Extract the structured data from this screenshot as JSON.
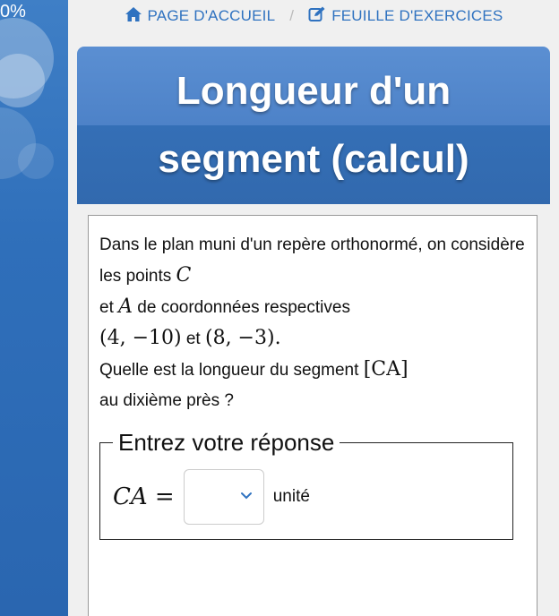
{
  "progress": "0%",
  "breadcrumb": {
    "home_label": "PAGE D'ACCUEIL",
    "separator": "/",
    "exercises_label": "FEUILLE D'EXERCICES"
  },
  "title": {
    "line1": "Longueur d'un",
    "line2": "segment (calcul)"
  },
  "question": {
    "part1": "Dans le plan muni d'un repère orthonormé, on considère les points ",
    "point1": "C",
    "part2": " et ",
    "point2": "A",
    "part3": " de coordonnées respectives",
    "coord1": "(4, −10)",
    "part4": " et ",
    "coord2": "(8, −3).",
    "part5": "Quelle est la longueur du segment ",
    "segment": "[CA]",
    "part6": " au dixième près ?"
  },
  "answer": {
    "legend": "Entrez votre réponse",
    "label_var": "CA",
    "label_eq": " =",
    "select_value": "",
    "unit": "unité"
  },
  "colors": {
    "accent": "#2f72c0",
    "title_top": "#5b8fd2",
    "title_bottom": "#3269ae"
  }
}
